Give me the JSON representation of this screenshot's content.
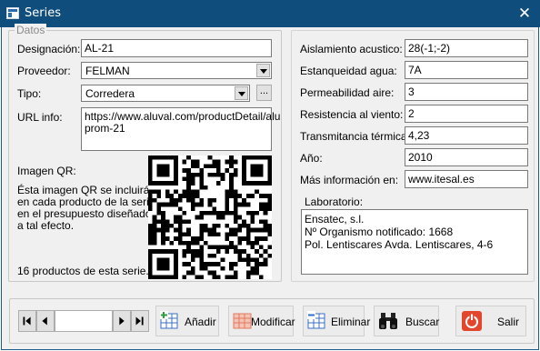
{
  "window": {
    "title": "Series"
  },
  "datos": {
    "legend": "Datos",
    "designacion": {
      "label": "Designación:",
      "value": "AL-21"
    },
    "proveedor": {
      "label": "Proveedor:",
      "value": "FELMAN"
    },
    "tipo": {
      "label": "Tipo:",
      "value": "Corredera",
      "more_label": "..."
    },
    "url": {
      "label": "URL info:",
      "line1": "https://www.aluval.com/productDetail/alu",
      "line2": "prom-21"
    },
    "qr": {
      "label": "Imagen QR:",
      "note_lines": [
        "Ésta imagen QR se incluirá",
        "en cada producto de la serie",
        "en el presupuesto diseñado",
        "a tal efecto."
      ]
    },
    "count_text": "16 productos de esta serie."
  },
  "props": [
    {
      "label": "Aislamiento acustico:",
      "value": "28(-1;-2)"
    },
    {
      "label": "Estanqueidad agua:",
      "value": "7A"
    },
    {
      "label": "Permeabilidad aire:",
      "value": "3"
    },
    {
      "label": "Resistencia al viento:",
      "value": "2"
    },
    {
      "label": "Transmitancia térmica:",
      "value": "4,23"
    },
    {
      "label": "Año:",
      "value": "2010"
    },
    {
      "label": "Más información en:",
      "value": "www.itesal.es"
    }
  ],
  "laboratorio": {
    "label": "Laboratorio:",
    "lines": [
      "Ensatec, s.l.",
      "Nº Organismo notificado: 1668",
      "Pol. Lentiscares Avda. Lentiscares, 4-6"
    ]
  },
  "toolbar": {
    "nav_value": "",
    "add": "Añadir",
    "edit": "Modificar",
    "delete": "Eliminar",
    "search": "Buscar",
    "exit": "Salir"
  },
  "colors": {
    "titlebar": "#0f4e7c",
    "window_bg": "#f0f0f0",
    "exit_icon": "#e2462d",
    "grid_icon": "#e07a5f",
    "grid_icon_blue": "#3a6fc4"
  }
}
